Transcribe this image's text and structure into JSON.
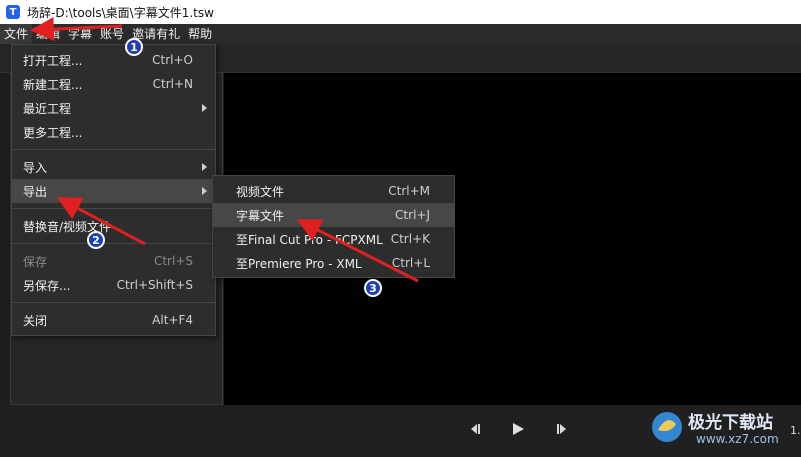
{
  "window": {
    "title": "场辞-D:\\tools\\桌面\\字幕文件1.tsw",
    "icon": "T"
  },
  "menubar": [
    "文件",
    "编辑",
    "字幕",
    "账号",
    "邀请有礼",
    "帮助"
  ],
  "file_menu": {
    "items": [
      {
        "label": "打开工程...",
        "shortcut": "Ctrl+O"
      },
      {
        "label": "新建工程...",
        "shortcut": "Ctrl+N"
      },
      {
        "label": "最近工程",
        "shortcut": ""
      },
      {
        "label": "更多工程...",
        "shortcut": ""
      },
      {
        "label": "导入",
        "shortcut": ""
      },
      {
        "label": "导出",
        "shortcut": ""
      },
      {
        "label": "替换音/视频文件",
        "shortcut": ""
      },
      {
        "label": "保存",
        "shortcut": "Ctrl+S"
      },
      {
        "label": "另保存...",
        "shortcut": "Ctrl+Shift+S"
      },
      {
        "label": "关闭",
        "shortcut": "Alt+F4"
      }
    ]
  },
  "export_submenu": {
    "items": [
      {
        "label": "视频文件",
        "shortcut": "Ctrl+M"
      },
      {
        "label": "字幕文件",
        "shortcut": "Ctrl+J"
      },
      {
        "label": "至Final Cut Pro - FCPXML",
        "shortcut": "Ctrl+K"
      },
      {
        "label": "至Premiere Pro - XML",
        "shortcut": "Ctrl+L"
      }
    ]
  },
  "annotations": {
    "badge1": "1",
    "badge2": "2",
    "badge3": "3"
  },
  "player": {
    "time_fragment": "1."
  },
  "watermark": {
    "brand": "极光下载站",
    "url": "www.xz7.com"
  },
  "colors": {
    "accent_badge": "#1f3fb8",
    "arrow": "#e02020",
    "menu_bg": "#2d2d2d",
    "highlight": "#474747"
  }
}
